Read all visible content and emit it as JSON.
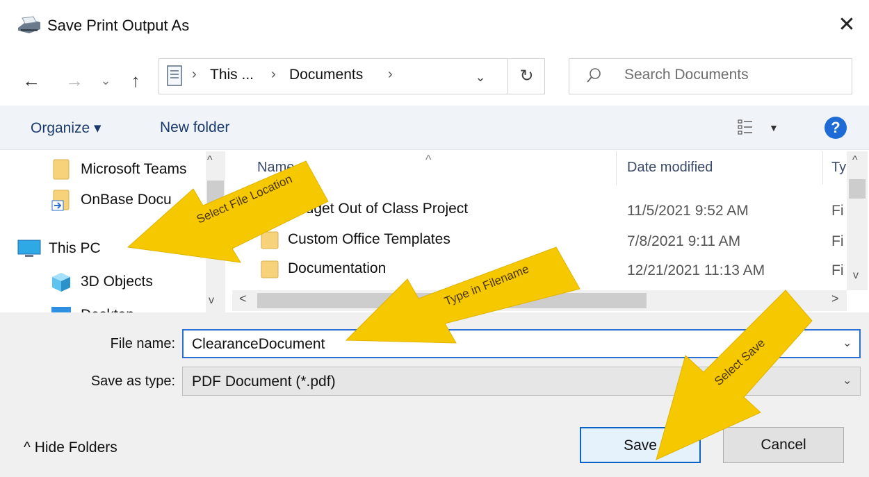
{
  "window": {
    "title": "Save Print Output As",
    "close_glyph": "✕"
  },
  "nav": {
    "back_glyph": "←",
    "forward_glyph": "→",
    "recent_glyph": "⌄",
    "up_glyph": "↑",
    "breadcrumb": [
      "This ...",
      "Documents"
    ],
    "sep_glyph": "›",
    "dropdown_glyph": "⌄",
    "refresh_glyph": "↻",
    "search_placeholder": "Search Documents"
  },
  "toolbar": {
    "organize_label": "Organize ▾",
    "new_folder_label": "New folder",
    "view_caret": "▼",
    "help_glyph": "?"
  },
  "sidebar": {
    "items": [
      {
        "label": "Microsoft Teams",
        "icon": "folder-icon"
      },
      {
        "label": "OnBase Docu",
        "icon": "link-folder-icon"
      },
      {
        "label": "This PC",
        "icon": "computer-icon"
      },
      {
        "label": "3D Objects",
        "icon": "cube-icon"
      },
      {
        "label": "Desktop",
        "icon": "desktop-icon"
      }
    ],
    "up_glyph": "^",
    "down_glyph": "v"
  },
  "file_list": {
    "columns": [
      "Name",
      "Date modified",
      "Ty"
    ],
    "sort_glyph": "^",
    "rows": [
      {
        "name": "Budget Out of Class Project",
        "date": "11/5/2021 9:52 AM",
        "type": "Fi"
      },
      {
        "name": "Custom Office Templates",
        "date": "7/8/2021 9:11 AM",
        "type": "Fi"
      },
      {
        "name": "Documentation",
        "date": "12/21/2021 11:13 AM",
        "type": "Fi"
      }
    ],
    "vscroll_up": "^",
    "vscroll_down": "v",
    "hscroll_left": "<",
    "hscroll_right": ">"
  },
  "form": {
    "file_name_label": "File name:",
    "file_name_value": "ClearanceDocument",
    "save_type_label": "Save as type:",
    "save_type_value": "PDF Document (*.pdf)",
    "caret": "⌄"
  },
  "footer": {
    "hide_folders_label": "^  Hide Folders",
    "save_label": "Save",
    "cancel_label": "Cancel"
  },
  "annotations": {
    "select_location": "Select File Location",
    "type_filename": "Type in Filename",
    "select_save": "Select Save",
    "arrow_color": "#f5c800"
  }
}
